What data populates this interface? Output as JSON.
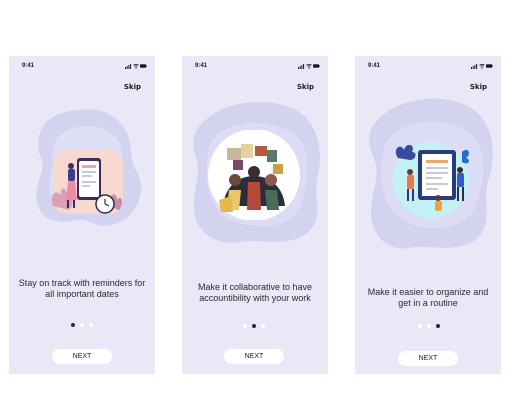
{
  "status_time": "9:41",
  "skip_label": "Skip",
  "next_label": "NEXT",
  "screens": [
    {
      "caption": "Stay on track with reminders for all important dates",
      "active_dot": 0
    },
    {
      "caption": "Make it collaborative to have accountibility with your work",
      "active_dot": 1
    },
    {
      "caption": "Make it easier to organize and get in a routine",
      "active_dot": 2
    }
  ],
  "colors": {
    "screen_bg": "#e8e8f7",
    "blob": "#d3d3f0",
    "accent_peach": "#f7d9cf",
    "accent_cyan": "#c4f1f6",
    "dot_active": "#2a2a3a"
  },
  "icons": [
    "signal-icon",
    "wifi-icon",
    "battery-icon"
  ]
}
